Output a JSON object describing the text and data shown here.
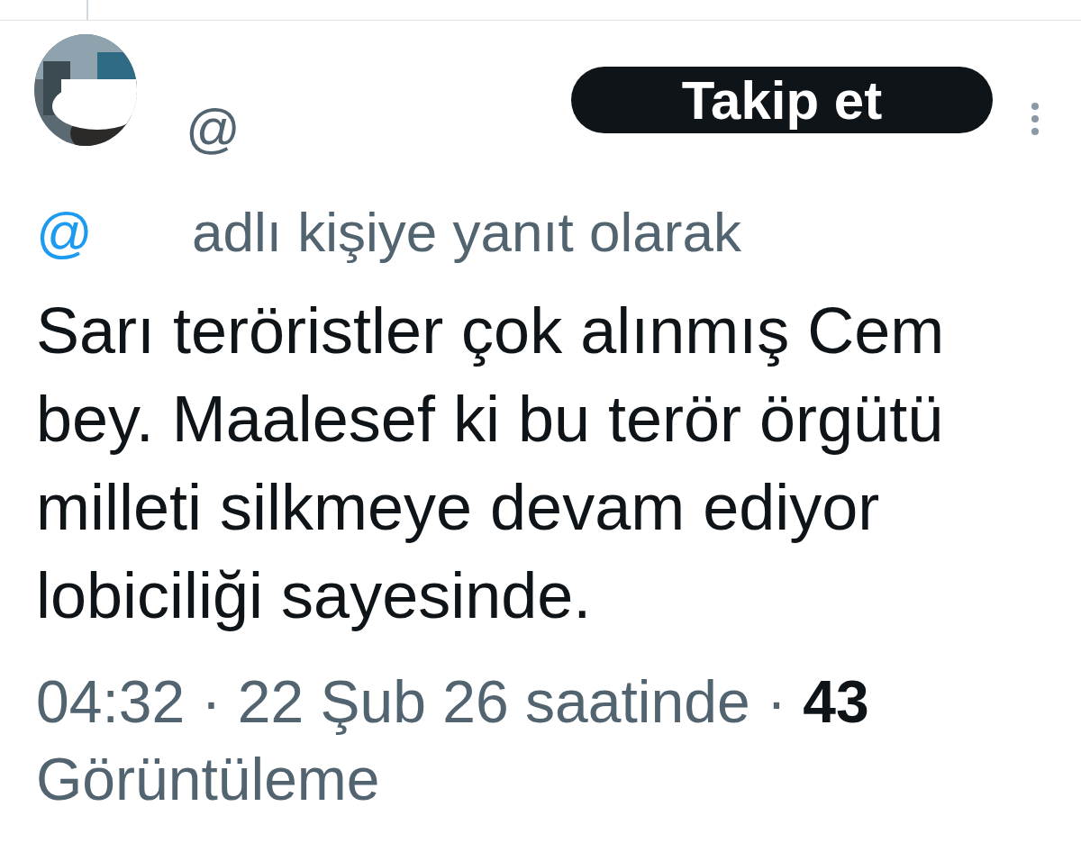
{
  "author": {
    "handle": "@"
  },
  "follow_button": {
    "label": "Takip et"
  },
  "reply_context": {
    "mention": "@",
    "text": "adlı kişiye yanıt olarak"
  },
  "tweet_text": "Sarı teröristler çok alınmış Cem bey. Maalesef ki bu terör örgütü milleti silkmeye devam ediyor lobiciliği sayesinde.",
  "meta": "04:32 · 22 Şub 26 saatinde · **43** Görüntüleme"
}
